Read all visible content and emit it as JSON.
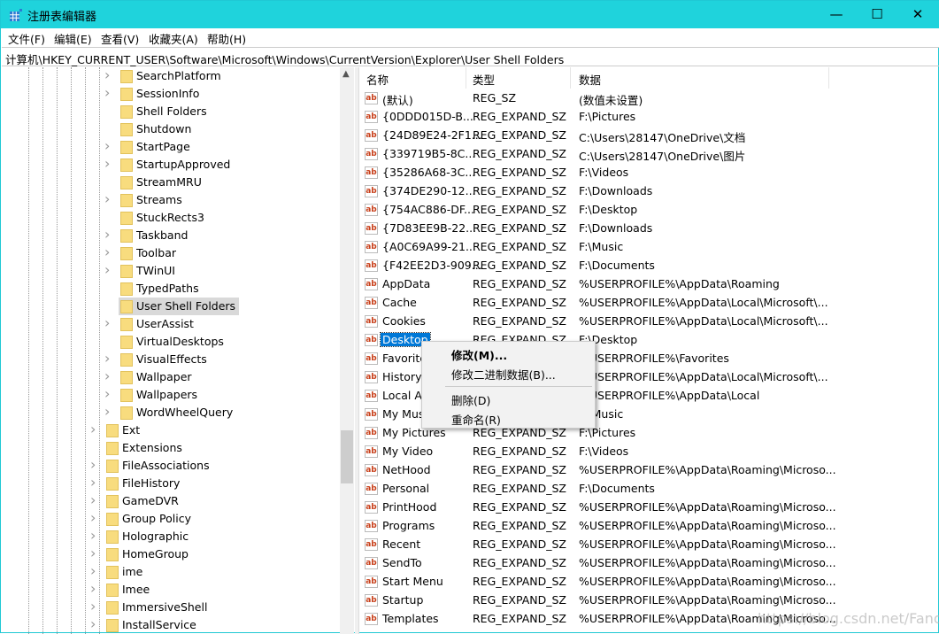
{
  "window": {
    "title": "注册表编辑器",
    "minimize": "—",
    "maximize": "☐",
    "close": "✕",
    "accent": "#1fd3dc"
  },
  "menu": [
    "文件(F)",
    "编辑(E)",
    "查看(V)",
    "收藏夹(A)",
    "帮助(H)"
  ],
  "address": "计算机\\HKEY_CURRENT_USER\\Software\\Microsoft\\Windows\\CurrentVersion\\Explorer\\User Shell Folders",
  "tree": {
    "items": [
      {
        "label": "SearchPlatform",
        "level": 2,
        "expandable": true
      },
      {
        "label": "SessionInfo",
        "level": 2,
        "expandable": true
      },
      {
        "label": "Shell Folders",
        "level": 2,
        "expandable": false
      },
      {
        "label": "Shutdown",
        "level": 2,
        "expandable": false
      },
      {
        "label": "StartPage",
        "level": 2,
        "expandable": true
      },
      {
        "label": "StartupApproved",
        "level": 2,
        "expandable": true
      },
      {
        "label": "StreamMRU",
        "level": 2,
        "expandable": false
      },
      {
        "label": "Streams",
        "level": 2,
        "expandable": true
      },
      {
        "label": "StuckRects3",
        "level": 2,
        "expandable": false
      },
      {
        "label": "Taskband",
        "level": 2,
        "expandable": true
      },
      {
        "label": "Toolbar",
        "level": 2,
        "expandable": true
      },
      {
        "label": "TWinUI",
        "level": 2,
        "expandable": true
      },
      {
        "label": "TypedPaths",
        "level": 2,
        "expandable": false
      },
      {
        "label": "User Shell Folders",
        "level": 2,
        "expandable": false,
        "selected": true
      },
      {
        "label": "UserAssist",
        "level": 2,
        "expandable": true
      },
      {
        "label": "VirtualDesktops",
        "level": 2,
        "expandable": false
      },
      {
        "label": "VisualEffects",
        "level": 2,
        "expandable": true
      },
      {
        "label": "Wallpaper",
        "level": 2,
        "expandable": true
      },
      {
        "label": "Wallpapers",
        "level": 2,
        "expandable": true
      },
      {
        "label": "WordWheelQuery",
        "level": 2,
        "expandable": true
      },
      {
        "label": "Ext",
        "level": 1,
        "expandable": true
      },
      {
        "label": "Extensions",
        "level": 1,
        "expandable": false
      },
      {
        "label": "FileAssociations",
        "level": 1,
        "expandable": true
      },
      {
        "label": "FileHistory",
        "level": 1,
        "expandable": true
      },
      {
        "label": "GameDVR",
        "level": 1,
        "expandable": true
      },
      {
        "label": "Group Policy",
        "level": 1,
        "expandable": true
      },
      {
        "label": "Holographic",
        "level": 1,
        "expandable": true
      },
      {
        "label": "HomeGroup",
        "level": 1,
        "expandable": true
      },
      {
        "label": "ime",
        "level": 1,
        "expandable": true
      },
      {
        "label": "Imee",
        "level": 1,
        "expandable": true
      },
      {
        "label": "ImmersiveShell",
        "level": 1,
        "expandable": true
      },
      {
        "label": "InstallService",
        "level": 1,
        "expandable": true
      }
    ]
  },
  "list": {
    "headers": {
      "name": "名称",
      "type": "类型",
      "data": "数据"
    },
    "rows": [
      {
        "name": "(默认)",
        "type": "REG_SZ",
        "data": "(数值未设置)"
      },
      {
        "name": "{0DDD015D-B...",
        "type": "REG_EXPAND_SZ",
        "data": "F:\\Pictures"
      },
      {
        "name": "{24D89E24-2F1...",
        "type": "REG_EXPAND_SZ",
        "data": "C:\\Users\\28147\\OneDrive\\文档"
      },
      {
        "name": "{339719B5-8C...",
        "type": "REG_EXPAND_SZ",
        "data": "C:\\Users\\28147\\OneDrive\\图片"
      },
      {
        "name": "{35286A68-3C...",
        "type": "REG_EXPAND_SZ",
        "data": "F:\\Videos"
      },
      {
        "name": "{374DE290-12...",
        "type": "REG_EXPAND_SZ",
        "data": "F:\\Downloads"
      },
      {
        "name": "{754AC886-DF...",
        "type": "REG_EXPAND_SZ",
        "data": "F:\\Desktop"
      },
      {
        "name": "{7D83EE9B-22...",
        "type": "REG_EXPAND_SZ",
        "data": "F:\\Downloads"
      },
      {
        "name": "{A0C69A99-21...",
        "type": "REG_EXPAND_SZ",
        "data": "F:\\Music"
      },
      {
        "name": "{F42EE2D3-909...",
        "type": "REG_EXPAND_SZ",
        "data": "F:\\Documents"
      },
      {
        "name": "AppData",
        "type": "REG_EXPAND_SZ",
        "data": "%USERPROFILE%\\AppData\\Roaming"
      },
      {
        "name": "Cache",
        "type": "REG_EXPAND_SZ",
        "data": "%USERPROFILE%\\AppData\\Local\\Microsoft\\..."
      },
      {
        "name": "Cookies",
        "type": "REG_EXPAND_SZ",
        "data": "%USERPROFILE%\\AppData\\Local\\Microsoft\\..."
      },
      {
        "name": "Desktop",
        "type": "REG_EXPAND_SZ",
        "data": "F:\\Desktop",
        "selected": true
      },
      {
        "name": "Favorite",
        "type": "REG_EXPAND_SZ",
        "data": "%USERPROFILE%\\Favorites"
      },
      {
        "name": "History",
        "type": "REG_EXPAND_SZ",
        "data": "%USERPROFILE%\\AppData\\Local\\Microsoft\\..."
      },
      {
        "name": "Local Ap",
        "type": "REG_EXPAND_SZ",
        "data": "%USERPROFILE%\\AppData\\Local"
      },
      {
        "name": "My Mus",
        "type": "REG_EXPAND_SZ",
        "data": "F:\\Music"
      },
      {
        "name": "My Pictures",
        "type": "REG_EXPAND_SZ",
        "data": "F:\\Pictures"
      },
      {
        "name": "My Video",
        "type": "REG_EXPAND_SZ",
        "data": "F:\\Videos"
      },
      {
        "name": "NetHood",
        "type": "REG_EXPAND_SZ",
        "data": "%USERPROFILE%\\AppData\\Roaming\\Microso..."
      },
      {
        "name": "Personal",
        "type": "REG_EXPAND_SZ",
        "data": "F:\\Documents"
      },
      {
        "name": "PrintHood",
        "type": "REG_EXPAND_SZ",
        "data": "%USERPROFILE%\\AppData\\Roaming\\Microso..."
      },
      {
        "name": "Programs",
        "type": "REG_EXPAND_SZ",
        "data": "%USERPROFILE%\\AppData\\Roaming\\Microso..."
      },
      {
        "name": "Recent",
        "type": "REG_EXPAND_SZ",
        "data": "%USERPROFILE%\\AppData\\Roaming\\Microso..."
      },
      {
        "name": "SendTo",
        "type": "REG_EXPAND_SZ",
        "data": "%USERPROFILE%\\AppData\\Roaming\\Microso..."
      },
      {
        "name": "Start Menu",
        "type": "REG_EXPAND_SZ",
        "data": "%USERPROFILE%\\AppData\\Roaming\\Microso..."
      },
      {
        "name": "Startup",
        "type": "REG_EXPAND_SZ",
        "data": "%USERPROFILE%\\AppData\\Roaming\\Microso..."
      },
      {
        "name": "Templates",
        "type": "REG_EXPAND_SZ",
        "data": "%USERPROFILE%\\AppData\\Roaming\\Microso..."
      }
    ]
  },
  "context_menu": {
    "modify": "修改(M)...",
    "modify_binary": "修改二进制数据(B)...",
    "delete": "删除(D)",
    "rename": "重命名(R)"
  },
  "watermark": "https://blog.csdn.net/Fanor_"
}
